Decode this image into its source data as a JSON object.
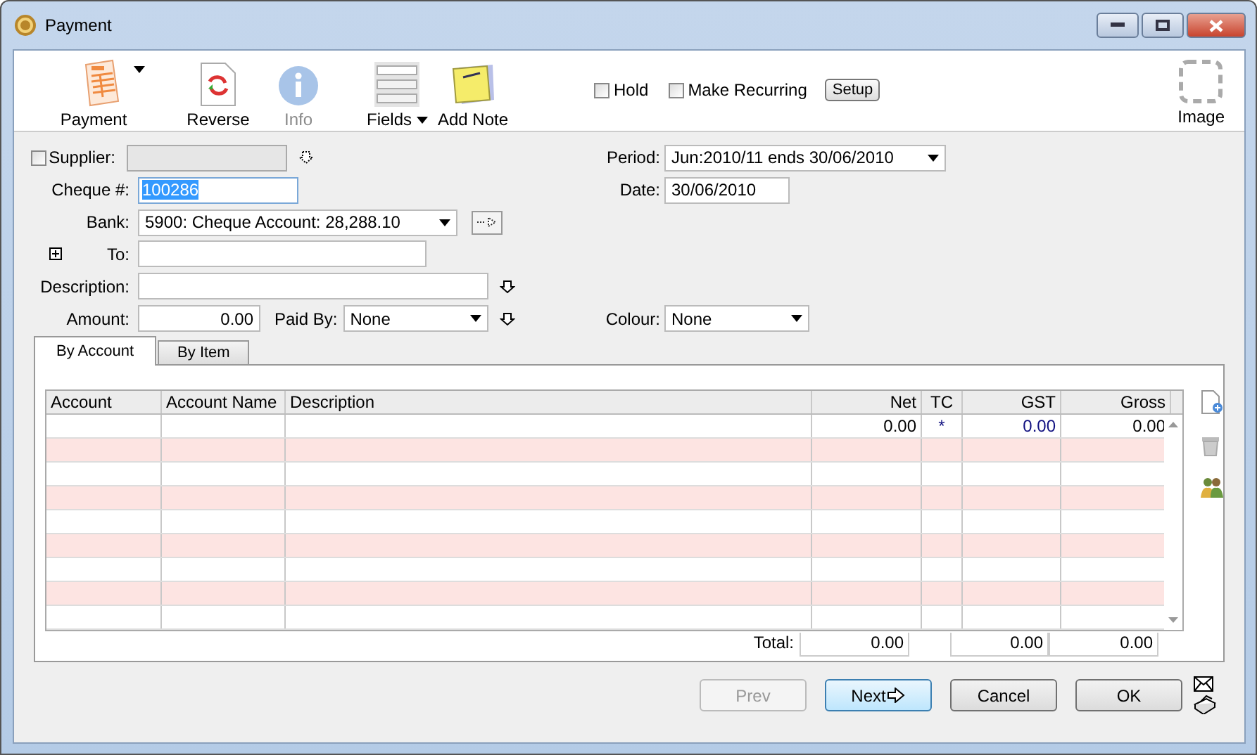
{
  "window": {
    "title": "Payment"
  },
  "toolbar": [
    {
      "kind": "form",
      "label": "Payment",
      "menu": true,
      "disabled": false
    },
    {
      "kind": "reverse",
      "label": "Reverse",
      "menu": false,
      "disabled": false
    },
    {
      "kind": "info",
      "label": "Info",
      "menu": false,
      "disabled": true
    },
    {
      "kind": "fields",
      "label": "Fields",
      "menu": true,
      "disabled": false
    },
    {
      "kind": "note",
      "label": "Add Note",
      "menu": false,
      "disabled": false
    }
  ],
  "toolbar_checks": [
    {
      "label": "Hold",
      "checked": false
    },
    {
      "label": "Make Recurring",
      "checked": false
    }
  ],
  "setup_button": "Setup",
  "image_button": "Image",
  "form": {
    "supplier": {
      "label": "Supplier:",
      "checked": false
    },
    "cheque": {
      "label": "Cheque #:",
      "value": "100286"
    },
    "bank": {
      "label": "Bank:",
      "value": "5900: Cheque Account: 28,288.10"
    },
    "to": {
      "label": "To:"
    },
    "description": {
      "label": "Description:"
    },
    "amount": {
      "label": "Amount:",
      "value": "0.00"
    },
    "paid_by": {
      "label": "Paid By:",
      "value": "None"
    },
    "period": {
      "label": "Period:",
      "value": "Jun:2010/11 ends 30/06/2010"
    },
    "date": {
      "label": "Date:",
      "value": "30/06/2010"
    },
    "colour": {
      "label": "Colour:",
      "value": "None"
    }
  },
  "tabs": [
    {
      "label": "By Account",
      "selected": true
    },
    {
      "label": "By Item",
      "selected": false
    }
  ],
  "table": {
    "columns": [
      "Account",
      "Account Name",
      "Description",
      "Net",
      "TC",
      "GST",
      "Gross"
    ],
    "rows": [
      [
        "",
        "",
        "",
        "0.00",
        "*",
        "0.00",
        "0.00"
      ]
    ],
    "total_label": "Total:",
    "totals": [
      "0.00",
      "0.00",
      "0.00"
    ]
  },
  "buttons": [
    {
      "label": "Prev",
      "disabled": true,
      "default": false
    },
    {
      "label": "Next",
      "disabled": false,
      "default": true
    },
    {
      "label": "Cancel",
      "disabled": false,
      "default": false
    },
    {
      "label": "OK",
      "disabled": false,
      "default": false
    }
  ]
}
